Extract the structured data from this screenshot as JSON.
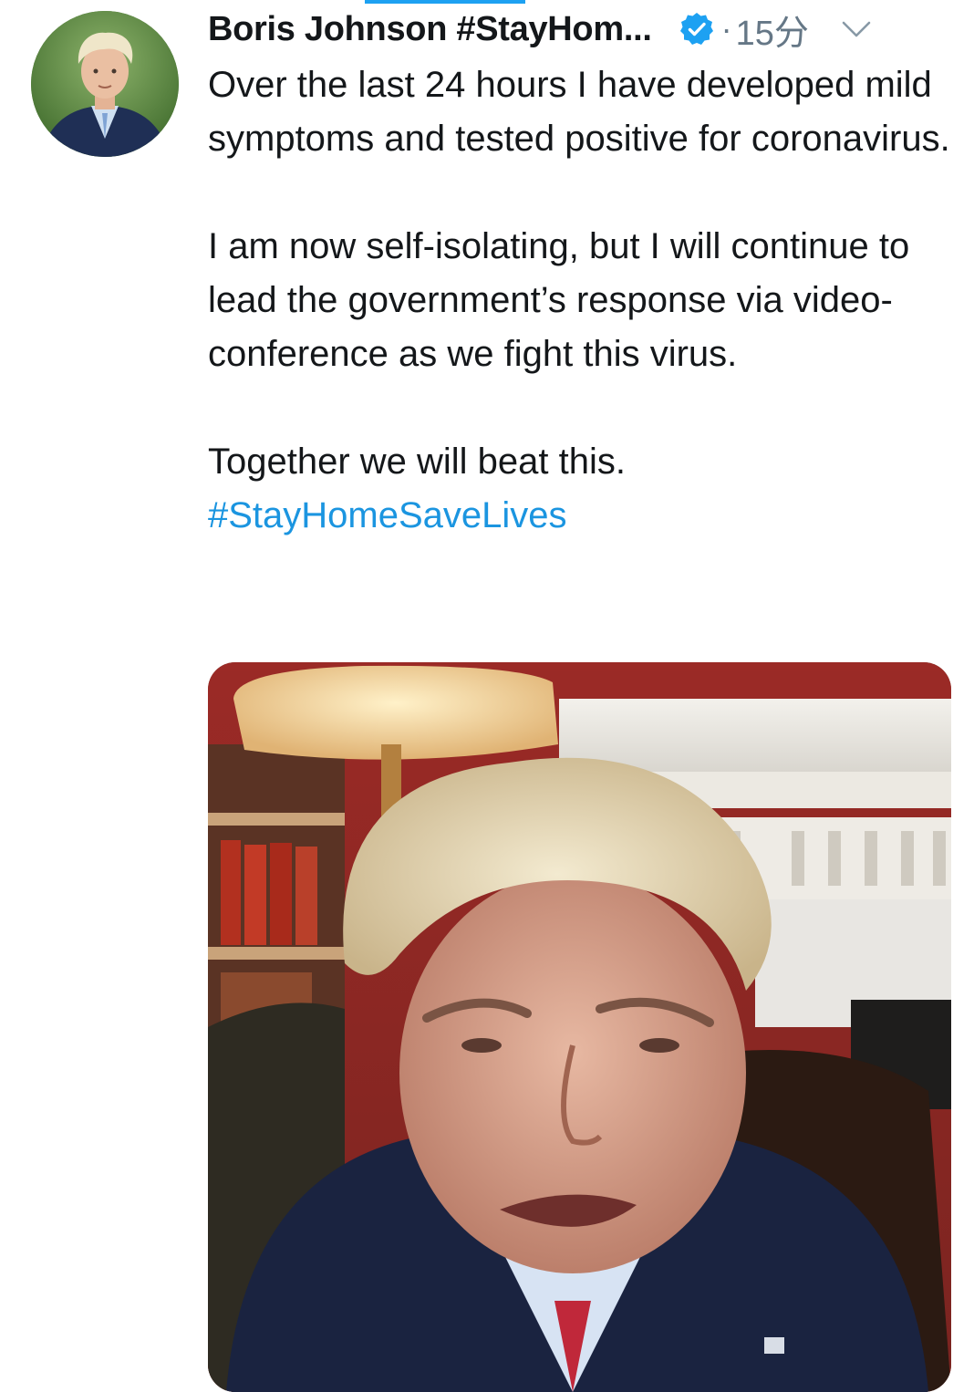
{
  "tweet": {
    "display_name": "Boris Johnson #StayHom...",
    "verified_icon": "verified-badge-icon",
    "separator": "·",
    "timestamp": "15分",
    "menu_icon": "chevron-down-icon",
    "paragraphs": [
      "Over the last 24 hours I have developed mild symptoms and tested positive for coronavirus.",
      "I am now self-isolating, but I will continue to lead the government’s response via video-conference as we fight this virus.",
      "Together we will beat this."
    ],
    "hashtag": "#StayHomeSaveLives"
  },
  "colors": {
    "link": "#1b95e0",
    "text": "#14171a",
    "muted": "#657786",
    "verified": "#1da1f2"
  }
}
